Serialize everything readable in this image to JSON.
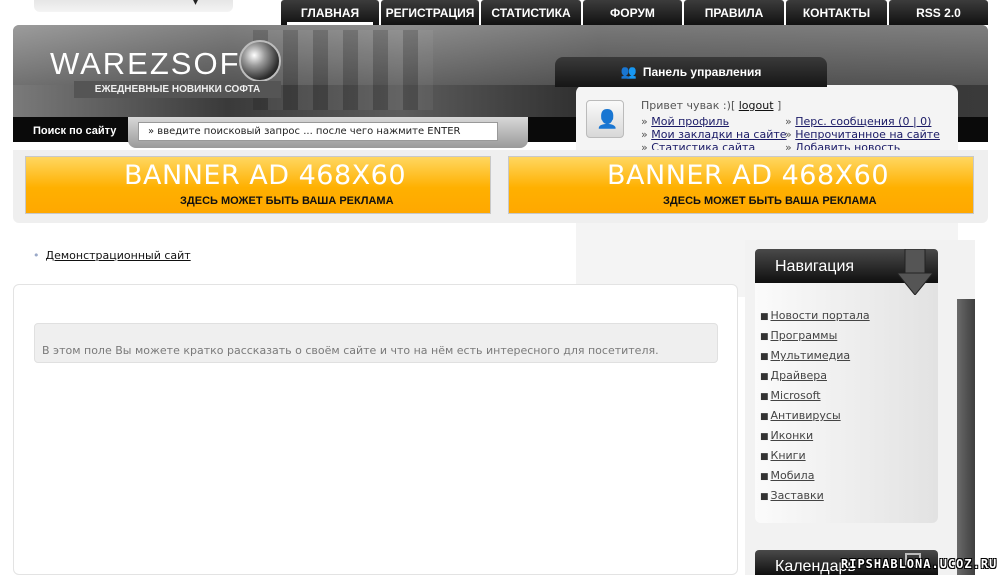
{
  "nav_tabs": [
    {
      "label": "ГЛАВНАЯ",
      "active": true
    },
    {
      "label": "РЕГИСТРАЦИЯ",
      "active": false
    },
    {
      "label": "СТАТИСТИКА",
      "active": false
    },
    {
      "label": "ФОРУМ",
      "active": false
    },
    {
      "label": "ПРАВИЛА",
      "active": false
    },
    {
      "label": "КОНТАКТЫ",
      "active": false
    },
    {
      "label": "RSS 2.0",
      "active": false
    }
  ],
  "header": {
    "logo_text": "WAREZSOFT",
    "slogan": "ЕЖЕДНЕВНЫЕ НОВИНКИ СОФТА",
    "search_label": "Поиск по сайту",
    "search_value": "» введите поисковый запрос ... после чего нажмите ENTER"
  },
  "control_panel": {
    "title": "Панель управления",
    "greeting": "Привет чувак :)",
    "logout_open": "[",
    "logout_label": "logout",
    "logout_close": "]",
    "bullet": "»",
    "left_links": [
      "Мой профиль",
      "Мои закладки на сайте",
      "Статистика сайта"
    ],
    "right_links": [
      "Перс. сообщения (0 | 0)",
      "Непрочитанное на сайте",
      "Добавить новость"
    ]
  },
  "banners": [
    {
      "title": "BANNER AD 468X60",
      "subtitle": "ЗДЕСЬ МОЖЕТ БЫТЬ ВАША РЕКЛАМА"
    },
    {
      "title": "BANNER AD 468X60",
      "subtitle": "ЗДЕСЬ МОЖЕТ БЫТЬ ВАША РЕКЛАМА"
    }
  ],
  "breadcrumb": {
    "bullet": "•",
    "label": "Демонстрационный сайт"
  },
  "main": {
    "info_text": "В этом поле Вы можете кратко рассказать о своём сайте и что на нём есть интересного для посетителя."
  },
  "sidebar": {
    "nav_title": "Навигация",
    "bullet": "■",
    "nav_items": [
      "Новости портала",
      "Программы",
      "Мультимедиа",
      "Драйвера",
      "Microsoft",
      "Антивирусы",
      "Иконки",
      "Книги",
      "Мобила",
      "Заставки"
    ],
    "calendar_title": "Календарь"
  },
  "watermark": "RIPSHABLONA.UCOZ.RU",
  "colors": {
    "banner_gold": "#ffb000",
    "dark_bar": "#111111",
    "link_dark_blue": "#1a1a66"
  },
  "icons": {
    "topbox": "chevron-down-icon",
    "globe": "globe-icon",
    "control_panel": "users-icon",
    "avatar": "user-card-icon",
    "nav_arrow": "arrow-down-icon"
  }
}
